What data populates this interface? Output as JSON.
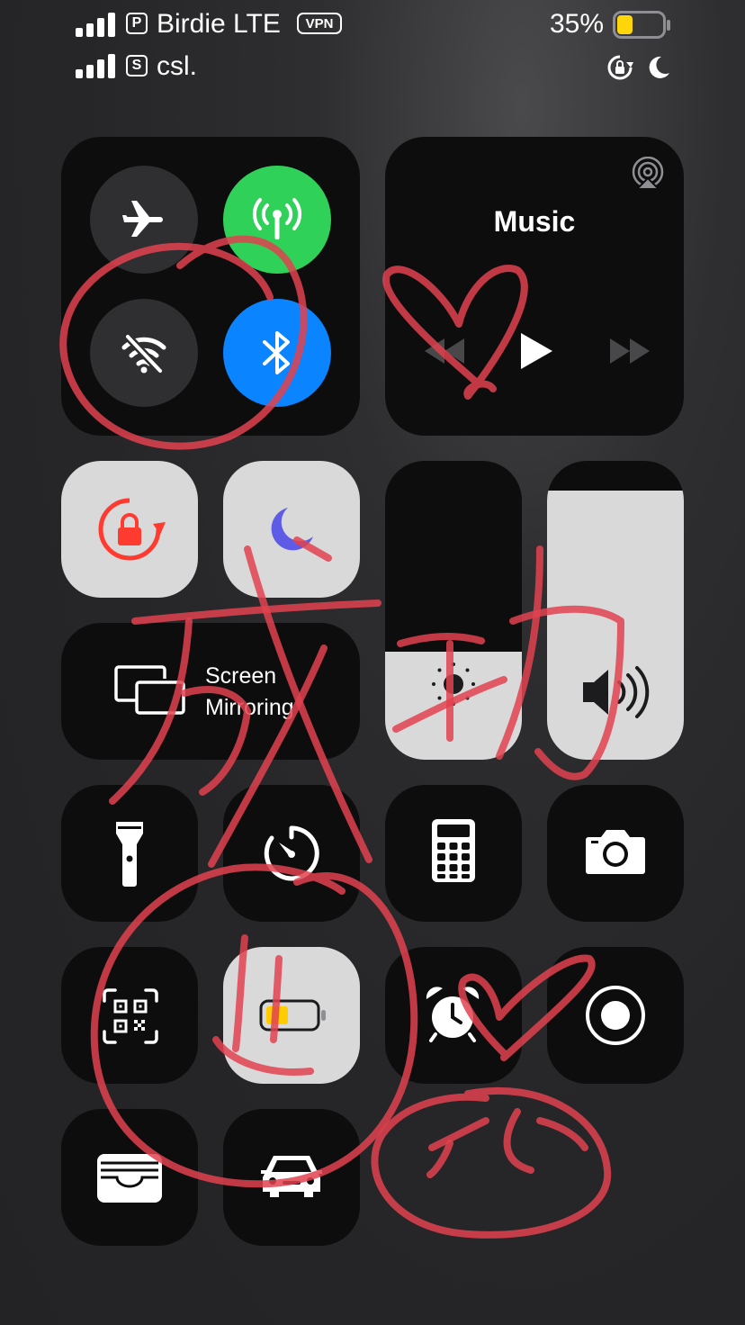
{
  "status_bar": {
    "carrier1": "Birdie LTE",
    "carrier1_badge": "P",
    "vpn": "VPN",
    "carrier2": "csl.",
    "carrier2_badge": "S",
    "battery_percent": "35%",
    "battery_level": 0.35,
    "battery_color": "#ffd60a"
  },
  "connectivity": {
    "airplane": {
      "icon": "airplane-icon",
      "active": false
    },
    "cellular": {
      "icon": "antenna-icon",
      "active": true,
      "color": "#30d158"
    },
    "wifi": {
      "icon": "wifi-off-icon",
      "active": false
    },
    "bluetooth": {
      "icon": "bluetooth-icon",
      "active": true,
      "color": "#0a84ff"
    }
  },
  "music": {
    "title": "Music"
  },
  "rotation_lock": {
    "icon": "rotation-lock-icon",
    "color": "#ff3b30"
  },
  "do_not_disturb": {
    "icon": "moon-icon",
    "color": "#5e5ce6"
  },
  "screen_mirroring": {
    "line1": "Screen",
    "line2": "Mirroring"
  },
  "brightness": {
    "icon": "sun-icon",
    "level": 0.36
  },
  "volume": {
    "icon": "speaker-icon",
    "level": 0.9
  },
  "tiles": [
    "flashlight",
    "timer",
    "calculator",
    "camera",
    "qr-code-scanner",
    "low-power-mode",
    "alarm",
    "screen-recording",
    "wallet",
    "car"
  ]
}
